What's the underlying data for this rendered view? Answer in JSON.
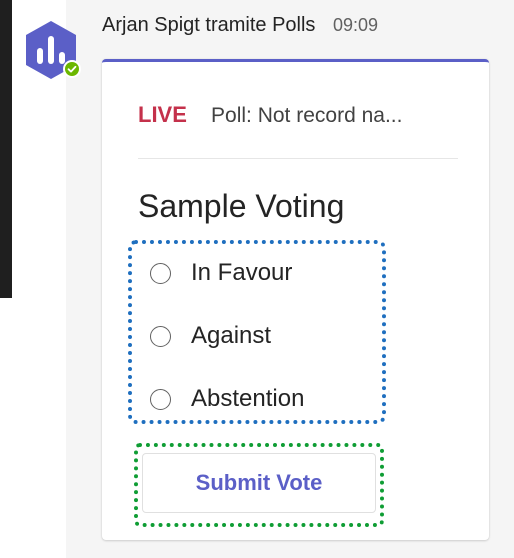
{
  "message": {
    "sender": "Arjan Spigt tramite Polls",
    "time": "09:09",
    "avatar_icon": "polls-app-icon",
    "presence": "available"
  },
  "card": {
    "live_label": "LIVE",
    "status_text": "Poll: Not record na...",
    "title": "Sample Voting",
    "options": [
      {
        "label": "In Favour",
        "selected": false
      },
      {
        "label": "Against",
        "selected": false
      },
      {
        "label": "Abstention",
        "selected": false
      }
    ],
    "submit_label": "Submit Vote"
  },
  "colors": {
    "accent": "#5b5fc7",
    "live": "#c4314b",
    "options_outline": "#1f6fbf",
    "submit_outline": "#0f9d34",
    "presence": "#6bb700"
  }
}
